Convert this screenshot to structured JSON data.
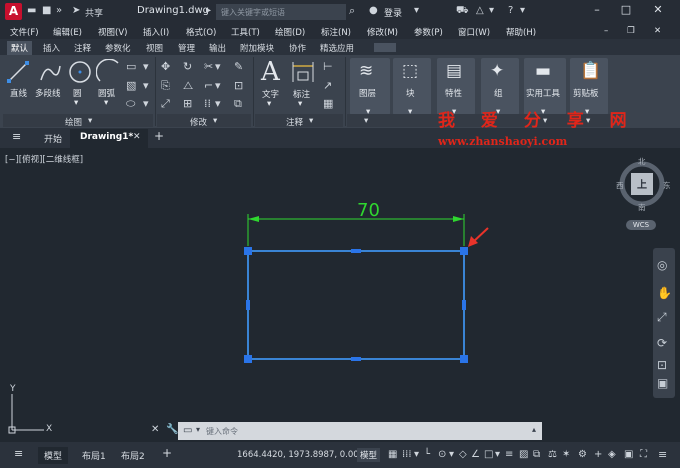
{
  "titlebar": {
    "logo": "A",
    "share": "共享",
    "doc_title": "Drawing1.dwg",
    "search_placeholder": "键入关键字或短语",
    "login": "登录"
  },
  "menubar": [
    "文件(F)",
    "编辑(E)",
    "视图(V)",
    "插入(I)",
    "格式(O)",
    "工具(T)",
    "绘图(D)",
    "标注(N)",
    "修改(M)",
    "参数(P)",
    "窗口(W)",
    "帮助(H)"
  ],
  "ribbon_tabs": [
    "默认",
    "插入",
    "注释",
    "参数化",
    "视图",
    "管理",
    "输出",
    "附加模块",
    "协作",
    "精选应用"
  ],
  "ribbon": {
    "draw_tools": [
      "直线",
      "多段线",
      "圆",
      "圆弧"
    ],
    "draw_panel": "绘图",
    "modify_panel": "修改",
    "annot_tools": [
      "文字",
      "标注"
    ],
    "annot_panel": "注释",
    "layer": "图层",
    "block": "块",
    "props": "特性",
    "group": "组",
    "utilities": "实用工具",
    "clipboard": "剪贴板"
  },
  "watermark": {
    "text": "我 爱 分 享 网",
    "url": "www.zhanshaoyi.com"
  },
  "doctabs": {
    "start": "开始",
    "drawing": "Drawing1*"
  },
  "canvas": {
    "view_label": "[−][俯视][二维线框]",
    "dimension": "70",
    "viewcube_top": "上",
    "dir_n": "北",
    "dir_s": "南",
    "dir_e": "东",
    "dir_w": "西",
    "wcs": "WCS",
    "axis_y": "Y",
    "axis_x": "X"
  },
  "cmdline": {
    "placeholder": "键入命令"
  },
  "statusbar": {
    "tabs": [
      "模型",
      "布局1",
      "布局2"
    ],
    "coords": "1664.4420, 1973.8987, 0.0000",
    "model": "模型"
  },
  "colors": {
    "rect_line": "#3e8ee6",
    "grip": "#2a74e8",
    "dim_green": "#2fd72f",
    "arrow_red": "#e8332a",
    "watermark_red": "#e0261a"
  }
}
